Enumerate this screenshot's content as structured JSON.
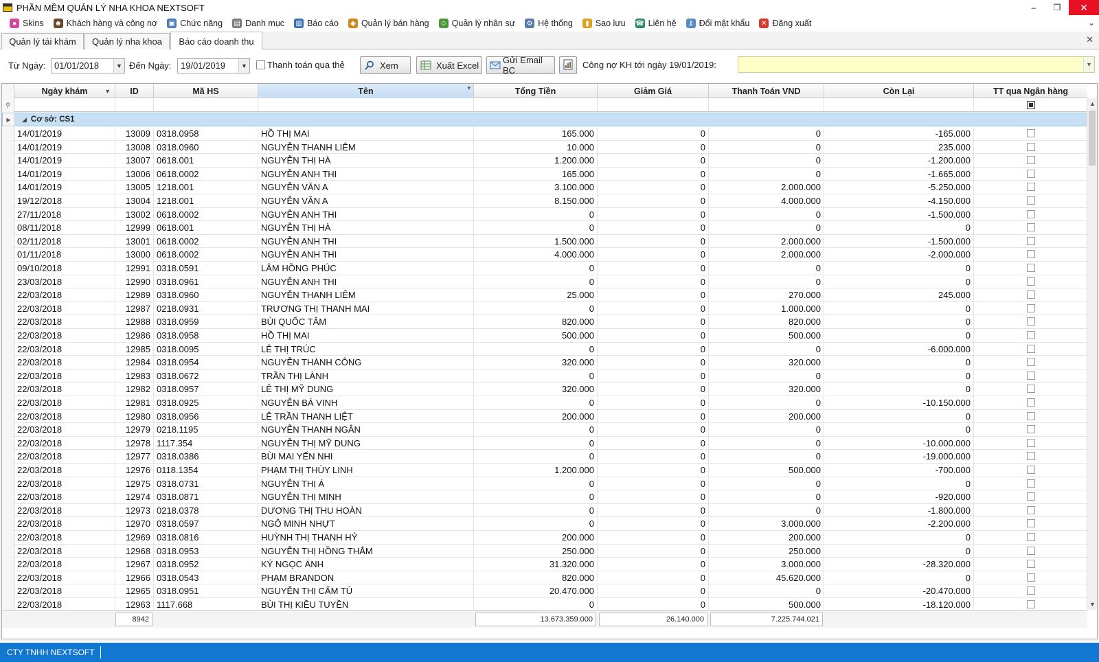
{
  "window": {
    "title": "PHẦN MỀM QUẢN LÝ NHA KHOA NEXTSOFT",
    "minimize": "–",
    "restore": "❐",
    "close": "✕"
  },
  "menu": [
    {
      "label": "Skins",
      "icon": "palette-icon",
      "color": "#d04a9b"
    },
    {
      "label": "Khách hàng và công nợ",
      "icon": "user-icon",
      "color": "#6b4a2b"
    },
    {
      "label": "Chức năng",
      "icon": "function-icon",
      "color": "#4a7ab8"
    },
    {
      "label": "Danh mục",
      "icon": "catalog-icon",
      "color": "#7a7a7a"
    },
    {
      "label": "Báo cáo",
      "icon": "report-icon",
      "color": "#3a6fb0"
    },
    {
      "label": "Quản lý bán hàng",
      "icon": "sales-icon",
      "color": "#d08a1a"
    },
    {
      "label": "Quản lý nhân sự",
      "icon": "people-icon",
      "color": "#4a9a3a"
    },
    {
      "label": "Hệ thống",
      "icon": "system-icon",
      "color": "#5a7ab0"
    },
    {
      "label": "Sao lưu",
      "icon": "backup-icon",
      "color": "#e0a020"
    },
    {
      "label": "Liên hệ",
      "icon": "contact-icon",
      "color": "#2a8a6a"
    },
    {
      "label": "Đổi mật khẩu",
      "icon": "key-icon",
      "color": "#5a8ac8"
    },
    {
      "label": "Đăng xuất",
      "icon": "logout-icon",
      "color": "#d83a2a"
    }
  ],
  "tabs": [
    {
      "label": "Quản lý tái khám"
    },
    {
      "label": "Quản lý nha khoa"
    },
    {
      "label": "Báo cáo doanh thu"
    }
  ],
  "toolbar": {
    "from_label": "Từ Ngày:",
    "from_value": "01/01/2018",
    "to_label": "Đến Ngày:",
    "to_value": "19/01/2019",
    "card_label": "Thanh toán qua thẻ",
    "view_label": "Xem",
    "excel_label": "Xuất Excel",
    "email_label": "Gửi Email BC",
    "debt_label": "Công nợ KH tới ngày 19/01/2019:"
  },
  "grid": {
    "columns": [
      "Ngày khám",
      "ID",
      "Mã HS",
      "Tên",
      "Tổng Tiền",
      "Giảm Giá",
      "Thanh Toán VND",
      "Còn Lại",
      "TT qua Ngân hàng"
    ],
    "group_label": "Cơ sở: CS1",
    "rows": [
      [
        "14/01/2019",
        "13009",
        "0318.0958",
        "HỒ THỊ MAI",
        "165.000",
        "0",
        "0",
        "-165.000"
      ],
      [
        "14/01/2019",
        "13008",
        "0318.0960",
        "NGUYỄN THANH LIÊM",
        "10.000",
        "0",
        "0",
        "235.000"
      ],
      [
        "14/01/2019",
        "13007",
        "0618.001",
        "NGUYỄN THỊ HÀ",
        "1.200.000",
        "0",
        "0",
        "-1.200.000"
      ],
      [
        "14/01/2019",
        "13006",
        "0618.0002",
        "NGUYỄN ANH THI",
        "165.000",
        "0",
        "0",
        "-1.665.000"
      ],
      [
        "14/01/2019",
        "13005",
        "1218.001",
        "NGUYỄN VĂN A",
        "3.100.000",
        "0",
        "2.000.000",
        "-5.250.000"
      ],
      [
        "19/12/2018",
        "13004",
        "1218.001",
        "NGUYỄN VĂN A",
        "8.150.000",
        "0",
        "4.000.000",
        "-4.150.000"
      ],
      [
        "27/11/2018",
        "13002",
        "0618.0002",
        "NGUYỄN ANH THI",
        "0",
        "0",
        "0",
        "-1.500.000"
      ],
      [
        "08/11/2018",
        "12999",
        "0618.001",
        "NGUYỄN THỊ HÀ",
        "0",
        "0",
        "0",
        "0"
      ],
      [
        "02/11/2018",
        "13001",
        "0618.0002",
        "NGUYỄN ANH THI",
        "1.500.000",
        "0",
        "2.000.000",
        "-1.500.000"
      ],
      [
        "01/11/2018",
        "13000",
        "0618.0002",
        "NGUYỄN ANH THI",
        "4.000.000",
        "0",
        "2.000.000",
        "-2.000.000"
      ],
      [
        "09/10/2018",
        "12991",
        "0318.0591",
        "LÂM HỒNG PHÚC",
        "0",
        "0",
        "0",
        "0"
      ],
      [
        "23/03/2018",
        "12990",
        "0318.0961",
        "NGUYỄN ANH THI",
        "0",
        "0",
        "0",
        "0"
      ],
      [
        "22/03/2018",
        "12989",
        "0318.0960",
        "NGUYỄN THANH LIÊM",
        "25.000",
        "0",
        "270.000",
        "245.000"
      ],
      [
        "22/03/2018",
        "12987",
        "0218.0931",
        "TRƯƠNG THỊ THANH MAI",
        "0",
        "0",
        "1.000.000",
        "0"
      ],
      [
        "22/03/2018",
        "12988",
        "0318.0959",
        "BÙI QUỐC TÂM",
        "820.000",
        "0",
        "820.000",
        "0"
      ],
      [
        "22/03/2018",
        "12986",
        "0318.0958",
        "HỒ THỊ MAI",
        "500.000",
        "0",
        "500.000",
        "0"
      ],
      [
        "22/03/2018",
        "12985",
        "0318.0095",
        "LÊ THỊ TRÚC",
        "0",
        "0",
        "0",
        "-6.000.000"
      ],
      [
        "22/03/2018",
        "12984",
        "0318.0954",
        "NGUYỄN THÀNH CÔNG",
        "320.000",
        "0",
        "320.000",
        "0"
      ],
      [
        "22/03/2018",
        "12983",
        "0318.0672",
        "TRẦN THỊ LÀNH",
        "0",
        "0",
        "0",
        "0"
      ],
      [
        "22/03/2018",
        "12982",
        "0318.0957",
        "LÊ THỊ MỸ DUNG",
        "320.000",
        "0",
        "320.000",
        "0"
      ],
      [
        "22/03/2018",
        "12981",
        "0318.0925",
        "NGUYỄN BÁ VINH",
        "0",
        "0",
        "0",
        "-10.150.000"
      ],
      [
        "22/03/2018",
        "12980",
        "0318.0956",
        "LÊ TRẦN THANH LIỆT",
        "200.000",
        "0",
        "200.000",
        "0"
      ],
      [
        "22/03/2018",
        "12979",
        "0218.1195",
        "NGUYỄN THANH NGÂN",
        "0",
        "0",
        "0",
        "0"
      ],
      [
        "22/03/2018",
        "12978",
        "1117.354",
        "NGUYỄN THỊ MỸ DUNG",
        "0",
        "0",
        "0",
        "-10.000.000"
      ],
      [
        "22/03/2018",
        "12977",
        "0318.0386",
        "BÙI MAI YẾN NHI",
        "0",
        "0",
        "0",
        "-19.000.000"
      ],
      [
        "22/03/2018",
        "12976",
        "0118.1354",
        "PHẠM THỊ THÙY LINH",
        "1.200.000",
        "0",
        "500.000",
        "-700.000"
      ],
      [
        "22/03/2018",
        "12975",
        "0318.0731",
        "NGUYỄN THỊ Á",
        "0",
        "0",
        "0",
        "0"
      ],
      [
        "22/03/2018",
        "12974",
        "0318.0871",
        "NGUYỄN THỊ MINH",
        "0",
        "0",
        "0",
        "-920.000"
      ],
      [
        "22/03/2018",
        "12973",
        "0218.0378",
        "DƯƠNG THỊ THU HOÀN",
        "0",
        "0",
        "0",
        "-1.800.000"
      ],
      [
        "22/03/2018",
        "12970",
        "0318.0597",
        "NGÔ MINH NHỰT",
        "0",
        "0",
        "3.000.000",
        "-2.200.000"
      ],
      [
        "22/03/2018",
        "12969",
        "0318.0816",
        "HUỲNH THỊ THANH HỶ",
        "200.000",
        "0",
        "200.000",
        "0"
      ],
      [
        "22/03/2018",
        "12968",
        "0318.0953",
        "NGUYỄN THỊ HỒNG THẮM",
        "250.000",
        "0",
        "250.000",
        "0"
      ],
      [
        "22/03/2018",
        "12967",
        "0318.0952",
        "KÝ NGỌC ÁNH",
        "31.320.000",
        "0",
        "3.000.000",
        "-28.320.000"
      ],
      [
        "22/03/2018",
        "12966",
        "0318.0543",
        "PHẠM BRANDON",
        "820.000",
        "0",
        "45.620.000",
        "0"
      ],
      [
        "22/03/2018",
        "12965",
        "0318.0951",
        "NGUYỄN THỊ CẨM TÚ",
        "20.470.000",
        "0",
        "0",
        "-20.470.000"
      ],
      [
        "22/03/2018",
        "12963",
        "1117.668",
        "BÙI THỊ KIỀU TUYỀN",
        "0",
        "0",
        "500.000",
        "-18.120.000"
      ]
    ],
    "totals": {
      "count": "8942",
      "tong_tien": "13.673.359.000",
      "giam_gia": "26.140.000",
      "thanh_toan": "7.225.744.021"
    }
  },
  "status": {
    "company": "CTY TNHH NEXTSOFT"
  }
}
